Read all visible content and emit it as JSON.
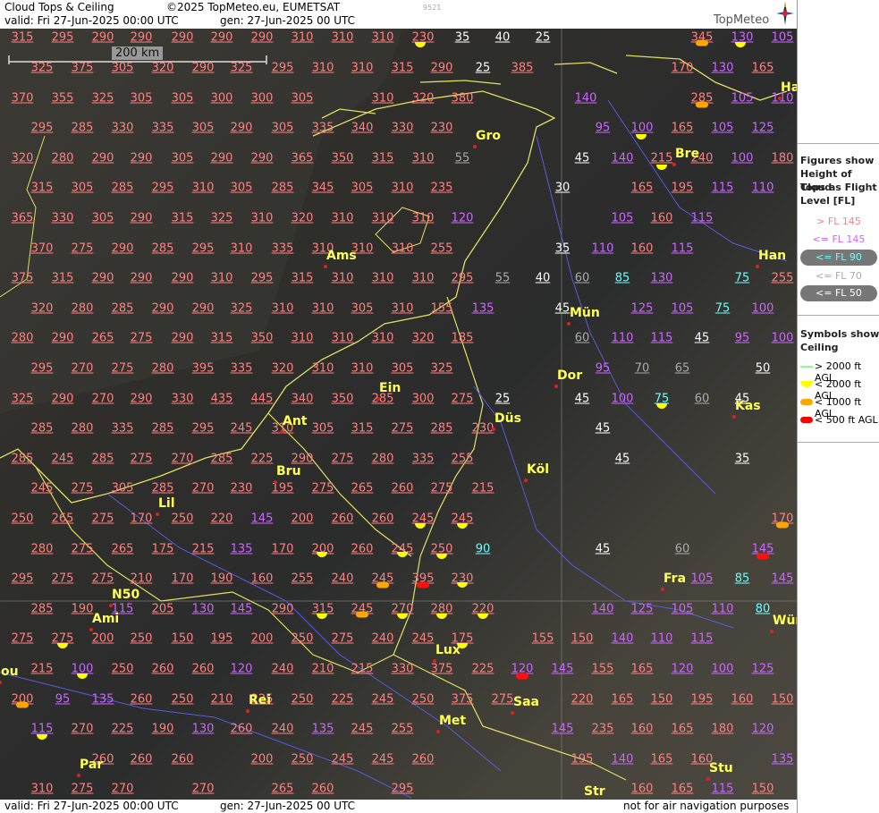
{
  "header": {
    "title": "Cloud Tops & Ceiling",
    "copyright": "©2025 TopMeteo.eu, EUMETSAT",
    "valid": "valid:  Fri  27-Jun-2025  00:00 UTC",
    "gen": "gen: 27-Jun-2025 00 UTC",
    "code": "9521",
    "brand": "TopMeteo"
  },
  "scale": {
    "label": "200 km"
  },
  "footer": {
    "valid": "valid:  Fri  27-Jun-2025  00:00 UTC",
    "gen": "gen: 27-Jun-2025 00 UTC",
    "disclaimer": "not for air navigation purposes"
  },
  "legend": {
    "title": [
      "Figures show",
      "Height of Cloud",
      "Tops as Flight",
      "Level  [FL]"
    ],
    "flight_levels": [
      {
        "text": "> FL 145",
        "color": "#ff8080"
      },
      {
        "text": "<= FL 145",
        "color": "#cc66ff"
      },
      {
        "text": "<= FL 90",
        "color": "#66ffff"
      },
      {
        "text": "<= FL 70",
        "color": "#aaaaaa"
      },
      {
        "text": "<= FL 50",
        "color": "#ffffff"
      }
    ],
    "symbols_title": [
      "Symbols show",
      "Ceiling"
    ],
    "symbols": [
      {
        "text": "> 2000 ft AGL",
        "color": "#88ff88",
        "shape": "line"
      },
      {
        "text": "< 2000 ft AGL",
        "color": "#ffff00",
        "shape": "half-circle"
      },
      {
        "text": "< 1000 ft AGL",
        "color": "#ffa500",
        "shape": "oval"
      },
      {
        "text": "< 500 ft AGL",
        "color": "#ff0000",
        "shape": "oval"
      }
    ]
  },
  "colors": {
    "high": "#ff8080",
    "mid": "#cc66ff",
    "fl90": "#66ffff",
    "fl70": "#aaaaaa",
    "fl50": "#ffffff",
    "city": "#ffff55"
  },
  "cities": [
    "Gro",
    "Bre",
    "Ham",
    "Han",
    "Ams",
    "Mün",
    "Dor",
    "Ein",
    "Kas",
    "Düs",
    "Ant",
    "Köl",
    "Bru",
    "Lil",
    "N50",
    "Ami",
    "Fra",
    "Wür",
    "Lux",
    "Saa",
    "Rei",
    "Met",
    "Par",
    "Stu",
    "Str",
    "ou"
  ],
  "cloud_tops": [
    [
      "315",
      "295",
      "290",
      "290",
      "290",
      "290",
      "290",
      "310",
      "310",
      "310",
      "230",
      "35",
      "40",
      "25",
      "345",
      "130",
      "105"
    ],
    [
      "325",
      "375",
      "305",
      "320",
      "290",
      "325",
      "295",
      "310",
      "310",
      "315",
      "290",
      "25",
      "385",
      "170",
      "130",
      "165"
    ],
    [
      "370",
      "355",
      "325",
      "305",
      "305",
      "300",
      "300",
      "305",
      "310",
      "320",
      "380",
      "285",
      "105",
      "110",
      "140"
    ],
    [
      "295",
      "285",
      "330",
      "335",
      "305",
      "290",
      "305",
      "335",
      "340",
      "330",
      "230",
      "95",
      "100",
      "165",
      "105",
      "125"
    ],
    [
      "320",
      "280",
      "290",
      "290",
      "305",
      "290",
      "290",
      "365",
      "350",
      "315",
      "310",
      "55",
      "45",
      "140",
      "215",
      "240",
      "100",
      "180"
    ],
    [
      "315",
      "305",
      "285",
      "295",
      "310",
      "305",
      "285",
      "345",
      "305",
      "310",
      "235",
      "30",
      "165",
      "195",
      "115",
      "110"
    ],
    [
      "365",
      "330",
      "305",
      "290",
      "315",
      "325",
      "310",
      "320",
      "310",
      "310",
      "310",
      "120",
      "105",
      "160",
      "115"
    ],
    [
      "370",
      "275",
      "290",
      "285",
      "295",
      "310",
      "335",
      "310",
      "310",
      "310",
      "255",
      "35",
      "110",
      "160",
      "115"
    ],
    [
      "375",
      "315",
      "290",
      "290",
      "290",
      "310",
      "295",
      "315",
      "310",
      "310",
      "310",
      "295",
      "55",
      "40",
      "60",
      "85",
      "130",
      "75",
      "255"
    ],
    [
      "320",
      "280",
      "285",
      "290",
      "290",
      "325",
      "310",
      "310",
      "305",
      "310",
      "155",
      "135",
      "45",
      "125",
      "105",
      "75",
      "100"
    ],
    [
      "280",
      "290",
      "265",
      "275",
      "290",
      "315",
      "350",
      "310",
      "310",
      "310",
      "320",
      "185",
      "60",
      "110",
      "115",
      "45",
      "95",
      "100"
    ],
    [
      "295",
      "270",
      "275",
      "280",
      "395",
      "335",
      "320",
      "310",
      "310",
      "305",
      "325",
      "95",
      "70",
      "65",
      "50"
    ],
    [
      "325",
      "290",
      "270",
      "290",
      "330",
      "435",
      "445",
      "340",
      "350",
      "285",
      "300",
      "275",
      "25",
      "45",
      "100",
      "75",
      "60",
      "45"
    ],
    [
      "285",
      "280",
      "335",
      "285",
      "295",
      "245",
      "310",
      "305",
      "315",
      "275",
      "285",
      "230",
      "45"
    ],
    [
      "285",
      "245",
      "285",
      "275",
      "270",
      "285",
      "225",
      "290",
      "275",
      "280",
      "335",
      "255",
      "45",
      "35"
    ],
    [
      "245",
      "275",
      "305",
      "285",
      "270",
      "230",
      "195",
      "275",
      "265",
      "260",
      "275",
      "215"
    ],
    [
      "250",
      "265",
      "275",
      "170",
      "250",
      "220",
      "145",
      "200",
      "260",
      "260",
      "245",
      "245",
      "170"
    ],
    [
      "280",
      "275",
      "265",
      "175",
      "215",
      "135",
      "170",
      "200",
      "260",
      "245",
      "250",
      "90",
      "45",
      "60",
      "145"
    ],
    [
      "295",
      "275",
      "275",
      "210",
      "170",
      "190",
      "160",
      "255",
      "240",
      "245",
      "395",
      "230",
      "105",
      "85",
      "145"
    ],
    [
      "285",
      "190",
      "115",
      "205",
      "130",
      "145",
      "290",
      "315",
      "245",
      "270",
      "280",
      "220",
      "140",
      "125",
      "105",
      "110",
      "80"
    ],
    [
      "275",
      "275",
      "200",
      "250",
      "150",
      "195",
      "200",
      "250",
      "275",
      "240",
      "245",
      "175",
      "155",
      "150",
      "140",
      "110",
      "115"
    ],
    [
      "215",
      "100",
      "250",
      "260",
      "260",
      "120",
      "240",
      "210",
      "215",
      "330",
      "375",
      "225",
      "120",
      "145",
      "155",
      "165",
      "120",
      "100",
      "125"
    ],
    [
      "200",
      "95",
      "135",
      "260",
      "250",
      "210",
      "225",
      "250",
      "225",
      "245",
      "250",
      "375",
      "275",
      "220",
      "165",
      "150",
      "195",
      "160",
      "150"
    ],
    [
      "115",
      "270",
      "225",
      "190",
      "130",
      "260",
      "240",
      "135",
      "245",
      "255",
      "145",
      "235",
      "160",
      "165",
      "180",
      "120"
    ],
    [
      "260",
      "260",
      "260",
      "200",
      "250",
      "245",
      "245",
      "260",
      "195",
      "140",
      "165",
      "160",
      "135"
    ],
    [
      "310",
      "275",
      "270",
      "270",
      "265",
      "260",
      "295",
      "160",
      "165",
      "115",
      "150"
    ]
  ]
}
